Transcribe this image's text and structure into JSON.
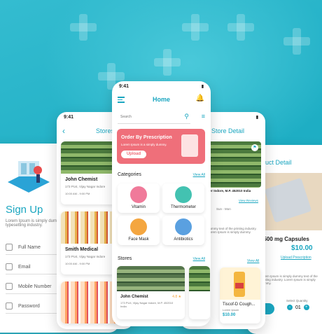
{
  "colors": {
    "accent": "#1aa6c0",
    "promo": "#ef6f7a",
    "price": "#1aa6c0"
  },
  "signup": {
    "title": "Sign Up",
    "desc": "Lorem Ipsum is simply dummy text of the printing and typesetting industry.",
    "fields": [
      "Full Name",
      "Email",
      "Mobile Number",
      "Password"
    ]
  },
  "stores": {
    "time": "9:41",
    "title": "Stores",
    "items": [
      {
        "name": "John Chemist",
        "addr": "173 PU4, Vijay Nagar Indore",
        "meta": "10:00 AM - 9:00 PM"
      },
      {
        "name": "Smith Medical",
        "addr": "173 PU4, Vijay Nagar Indore",
        "meta": "10:00 AM - 9:00 PM"
      }
    ]
  },
  "home": {
    "time": "9:41",
    "title": "Home",
    "search_placeholder": "Search",
    "promo": {
      "title": "Order By Prescription",
      "subtitle": "Lorem Ipsum is a simply dummy.",
      "button": "Upload"
    },
    "categories_title": "Categories",
    "view_all": "View All",
    "categories": [
      {
        "label": "Vitamin",
        "color": "#f07a9a"
      },
      {
        "label": "Thermometer",
        "color": "#43c2b1"
      },
      {
        "label": "Face Mask",
        "color": "#f4a640"
      },
      {
        "label": "Antibiotics",
        "color": "#5aa0e0"
      }
    ],
    "stores_title": "Stores",
    "stores_view_all": "View All",
    "store": {
      "name": "John Chemist",
      "rating": "4.8",
      "addr": "173 PU4, Vijay Nagar Indore, M.P. 452010 India"
    }
  },
  "store_detail": {
    "time": "9:41",
    "title": "Store Detail",
    "addr": "ger Indore, M.P. 452010 India",
    "view_reviews": "View Reviews",
    "hours": "Sun - Mon",
    "desc": "dummy text of the printing industry. Lorem Ipsum is simply dummy.",
    "view_all": "View All",
    "product": {
      "name": "Tiscof-D Cough...",
      "sub": "Lorem Ipsum",
      "price": "$10.00"
    }
  },
  "product_detail": {
    "time": "9:41",
    "title": "Product Detail",
    "name": "l 500 mg Capsules",
    "price": "$10.00",
    "upload": "Upload Prescription",
    "desc": "Lorem Ipsum is simply dummy text of the printing industry. Lorem Ipsum is simply dummy.",
    "qty_label": "Select Quantity",
    "qty": "01",
    "cart": "t"
  }
}
